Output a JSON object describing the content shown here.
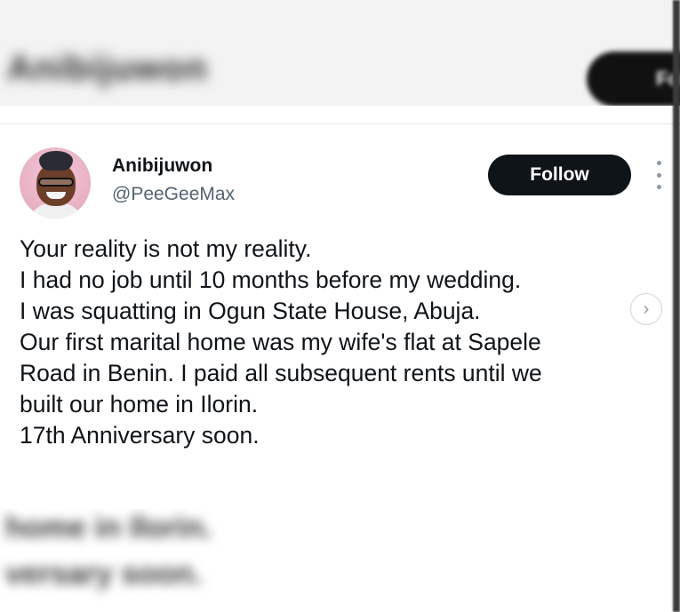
{
  "background": {
    "top_name": "Anibijuwon",
    "top_button": "Follow",
    "bottom_lines": [
      "home in Ilorin.",
      "versary soon."
    ]
  },
  "tweet": {
    "display_name": "Anibijuwon",
    "handle": "@PeeGeeMax",
    "follow_label": "Follow",
    "more_icon": "more-vertical-icon",
    "next_icon": "chevron-right-icon",
    "next_glyph": "›",
    "text_lines": [
      "Your reality is not my reality.",
      "I had no job until 10 months before my wedding.",
      "I was squatting in Ogun State House, Abuja.",
      "Our first marital home was my wife's flat at Sapele",
      "Road in Benin. I paid all subsequent rents until we",
      "built our home in Ilorin.",
      "17th Anniversary soon."
    ]
  },
  "colors": {
    "text_primary": "#0f1419",
    "text_secondary": "#536471",
    "button_bg": "#0f1419",
    "button_text": "#ffffff"
  }
}
